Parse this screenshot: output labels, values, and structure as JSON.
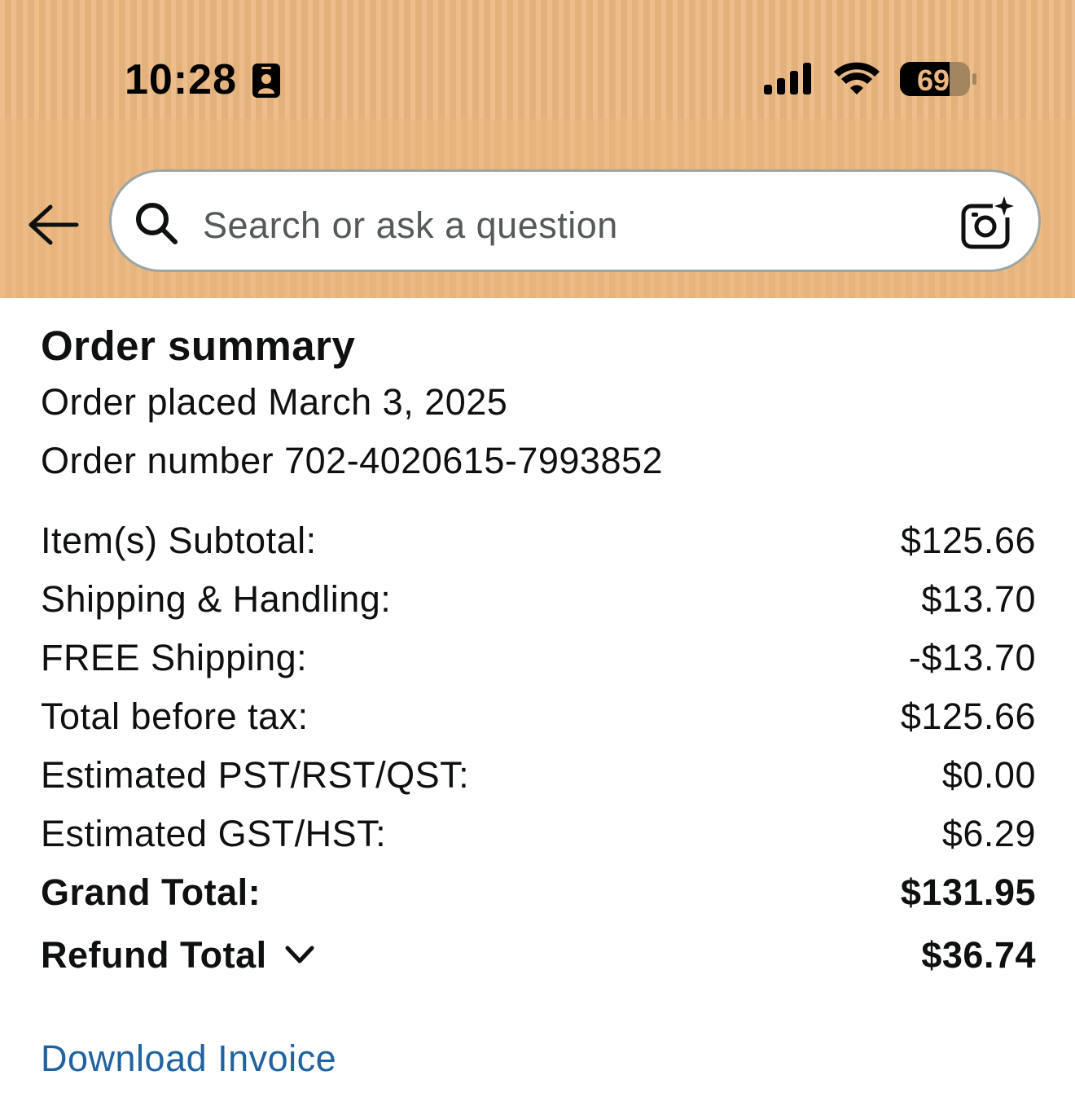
{
  "status_bar": {
    "time": "10:28",
    "battery_level": "69",
    "icons": [
      "contact-card-icon",
      "signal-bars-icon",
      "wifi-icon",
      "battery-icon"
    ]
  },
  "search": {
    "placeholder": "Search or ask a question",
    "icons": [
      "back-arrow-icon",
      "search-icon",
      "camera-sparkle-icon"
    ]
  },
  "summary": {
    "title": "Order summary",
    "order_placed": "Order placed March 3, 2025",
    "order_number": "Order number 702-4020615-7993852"
  },
  "lines": [
    {
      "label": "Item(s) Subtotal:",
      "value": "$125.66"
    },
    {
      "label": "Shipping & Handling:",
      "value": "$13.70"
    },
    {
      "label": "FREE Shipping:",
      "value": "-$13.70"
    },
    {
      "label": "Total before tax:",
      "value": "$125.66"
    },
    {
      "label": "Estimated PST/RST/QST:",
      "value": "$0.00"
    },
    {
      "label": "Estimated GST/HST:",
      "value": "$6.29"
    },
    {
      "label": "Grand Total:",
      "value": "$131.95"
    }
  ],
  "refund": {
    "label": "Refund Total",
    "value": "$36.74"
  },
  "download_invoice": "Download Invoice",
  "colors": {
    "header_bg": "#ebb77f",
    "link": "#2162a1",
    "text": "#0f1111"
  }
}
